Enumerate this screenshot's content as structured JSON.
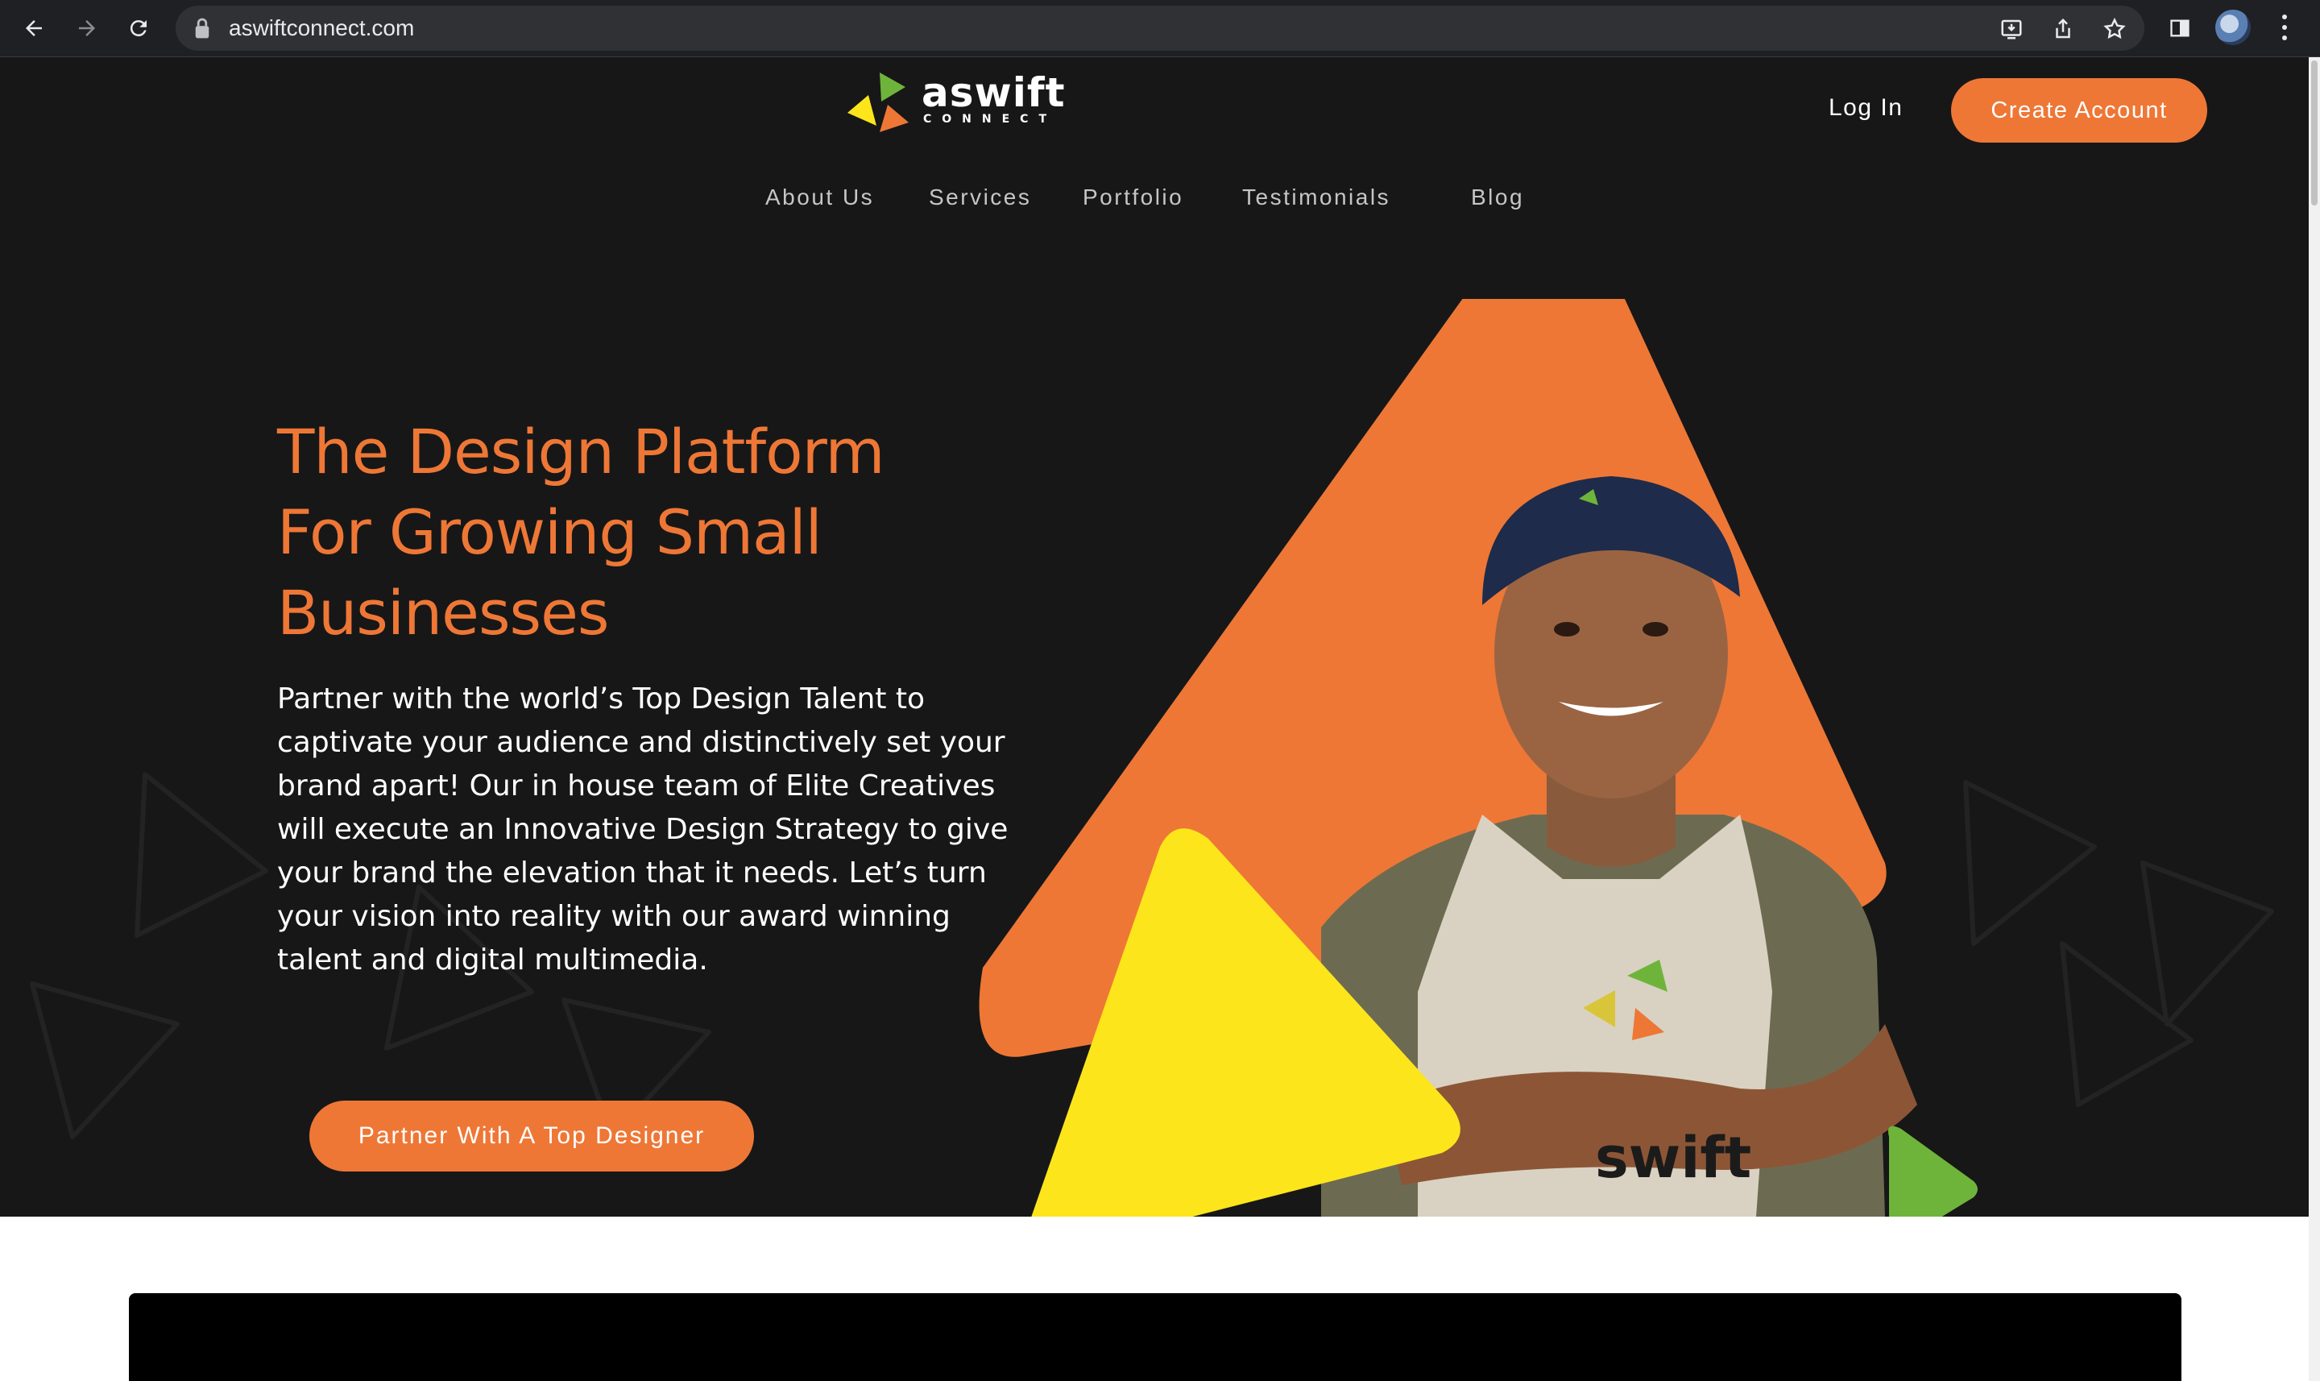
{
  "browser": {
    "url": "aswiftconnect.com",
    "icons": [
      "back-arrow-icon",
      "forward-arrow-icon",
      "reload-icon",
      "lock-icon",
      "install-icon",
      "share-icon",
      "bookmark-star-icon",
      "side-panel-icon",
      "profile-avatar",
      "more-menu-icon"
    ]
  },
  "header": {
    "logo_word": "aswift",
    "logo_sub": "CONNECT",
    "login_label": "Log In",
    "create_account_label": "Create Account"
  },
  "nav": {
    "items": [
      {
        "label": "About Us"
      },
      {
        "label": "Services"
      },
      {
        "label": "Portfolio"
      },
      {
        "label": "Testimonials"
      },
      {
        "label": "Blog"
      }
    ]
  },
  "hero": {
    "headline_lines": [
      "The Design Platform",
      "For Growing Small",
      "Businesses"
    ],
    "paragraph_lines": [
      "Partner with the world’s Top Design Talent to",
      "captivate your audience and distinctively set your",
      "brand apart! Our in house team of Elite Creatives",
      "will execute an Innovative Design Strategy to give",
      "your brand the elevation that it needs. Let’s turn",
      "your vision into reality with our award winning",
      "talent and digital multimedia."
    ],
    "cta_label": "Partner With A Top Designer",
    "apron_text": "swift"
  },
  "colors": {
    "accent_orange": "#ee7736",
    "yellow": "#fde51c",
    "green": "#6fb43a",
    "page_dark": "#171717"
  }
}
